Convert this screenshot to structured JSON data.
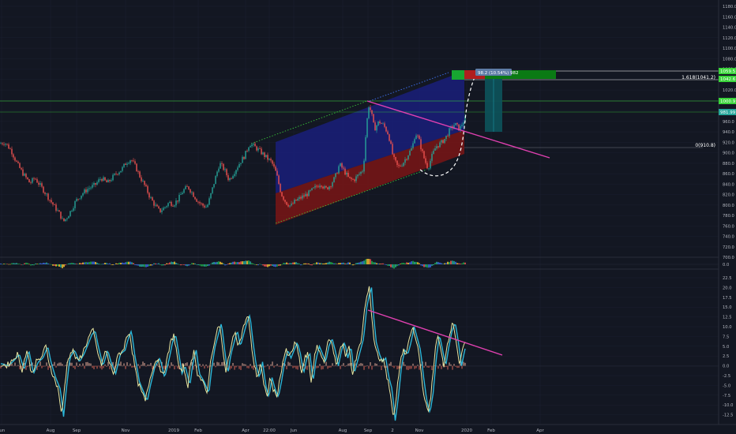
{
  "chart_data": {
    "type": "line",
    "symbol_label": "",
    "colors": {
      "background": "#131722",
      "grid": "#1c2030",
      "axis_text": "#b2b5be",
      "candle_up": "#26a69a",
      "candle_down": "#ef5350",
      "upper_channel_fill": "#1a1f7a",
      "lower_channel_fill": "#7a1515",
      "trend_line": "#e040b0",
      "profit_zone": "#0a7a14",
      "loss_zone": "#b01e1e",
      "oscillator_fast": "#e8e6a0",
      "oscillator_slow": "#2bb6d8",
      "level_green": "#3ad43a",
      "level_white": "#ffffff",
      "level_teal": "#26c6da"
    },
    "price_axis": {
      "ticks": [
        "1180.0",
        "1160.0",
        "1140.0",
        "1120.0",
        "1100.0",
        "1080.0",
        "1060.0",
        "1040.0",
        "1020.0",
        "1000.0",
        "980.0",
        "960.0",
        "940.0",
        "920.0",
        "900.0",
        "880.0",
        "860.0",
        "840.0",
        "820.0",
        "800.0",
        "780.0",
        "760.0",
        "740.0",
        "720.0",
        "700.0"
      ],
      "ylim": [
        700,
        1180
      ]
    },
    "histogram_axis": {
      "ticks": [
        "0.0"
      ]
    },
    "oscillator_axis": {
      "ticks": [
        "22.5",
        "20.0",
        "17.5",
        "15.0",
        "12.5",
        "10.0",
        "7.5",
        "5.0",
        "2.5",
        "0.0",
        "-2.5",
        "-5.0",
        "-7.5",
        "-10.0",
        "-12.5"
      ],
      "ylim": [
        -15,
        23.5
      ]
    },
    "time_axis": {
      "labels": [
        "Jun",
        "Aug",
        "Sep",
        "Nov",
        "2019",
        "Feb",
        "Apr",
        "22:00",
        "Jun",
        "Aug",
        "Sep",
        "2",
        "Nov",
        "2020",
        "Feb",
        "Apr"
      ]
    },
    "price_keypoints": [
      [
        0,
        918
      ],
      [
        6,
        920
      ],
      [
        14,
        905
      ],
      [
        22,
        878
      ],
      [
        30,
        858
      ],
      [
        38,
        842
      ],
      [
        44,
        852
      ],
      [
        52,
        835
      ],
      [
        58,
        822
      ],
      [
        64,
        808
      ],
      [
        70,
        795
      ],
      [
        76,
        782
      ],
      [
        80,
        768
      ],
      [
        84,
        775
      ],
      [
        90,
        790
      ],
      [
        96,
        808
      ],
      [
        104,
        822
      ],
      [
        112,
        832
      ],
      [
        120,
        838
      ],
      [
        128,
        852
      ],
      [
        136,
        842
      ],
      [
        142,
        852
      ],
      [
        148,
        862
      ],
      [
        154,
        868
      ],
      [
        160,
        882
      ],
      [
        166,
        888
      ],
      [
        172,
        872
      ],
      [
        178,
        852
      ],
      [
        184,
        835
      ],
      [
        190,
        815
      ],
      [
        196,
        800
      ],
      [
        202,
        788
      ],
      [
        208,
        795
      ],
      [
        214,
        805
      ],
      [
        220,
        802
      ],
      [
        226,
        812
      ],
      [
        232,
        828
      ],
      [
        238,
        835
      ],
      [
        244,
        822
      ],
      [
        250,
        808
      ],
      [
        256,
        800
      ],
      [
        262,
        796
      ],
      [
        266,
        815
      ],
      [
        272,
        848
      ],
      [
        278,
        880
      ],
      [
        284,
        868
      ],
      [
        290,
        848
      ],
      [
        296,
        862
      ],
      [
        304,
        882
      ],
      [
        310,
        895
      ],
      [
        316,
        918
      ],
      [
        322,
        912
      ],
      [
        330,
        902
      ],
      [
        338,
        890
      ],
      [
        344,
        882
      ],
      [
        350,
        860
      ],
      [
        356,
        822
      ],
      [
        362,
        805
      ],
      [
        368,
        798
      ],
      [
        374,
        808
      ],
      [
        382,
        815
      ],
      [
        390,
        822
      ],
      [
        398,
        832
      ],
      [
        406,
        842
      ],
      [
        412,
        830
      ],
      [
        418,
        838
      ],
      [
        424,
        852
      ],
      [
        430,
        878
      ],
      [
        436,
        865
      ],
      [
        442,
        850
      ],
      [
        448,
        848
      ],
      [
        454,
        858
      ],
      [
        460,
        868
      ],
      [
        464,
        952
      ],
      [
        467,
        990
      ],
      [
        470,
        978
      ],
      [
        474,
        945
      ],
      [
        480,
        960
      ],
      [
        486,
        952
      ],
      [
        492,
        935
      ],
      [
        498,
        890
      ],
      [
        504,
        872
      ],
      [
        510,
        880
      ],
      [
        516,
        895
      ],
      [
        522,
        910
      ],
      [
        526,
        938
      ],
      [
        530,
        928
      ],
      [
        534,
        905
      ],
      [
        538,
        885
      ],
      [
        542,
        870
      ],
      [
        546,
        890
      ],
      [
        552,
        912
      ],
      [
        558,
        918
      ],
      [
        564,
        928
      ],
      [
        570,
        945
      ],
      [
        576,
        955
      ],
      [
        582,
        945
      ],
      [
        586,
        958
      ],
      [
        590,
        968
      ]
    ],
    "oscillator_keypoints": [
      [
        0,
        0.5
      ],
      [
        8,
        0
      ],
      [
        16,
        1.5
      ],
      [
        22,
        3
      ],
      [
        28,
        -1
      ],
      [
        34,
        4
      ],
      [
        40,
        -2
      ],
      [
        46,
        1
      ],
      [
        52,
        2
      ],
      [
        58,
        5
      ],
      [
        62,
        1
      ],
      [
        68,
        -3
      ],
      [
        74,
        -6
      ],
      [
        78,
        -13
      ],
      [
        82,
        -5
      ],
      [
        86,
        2
      ],
      [
        92,
        4
      ],
      [
        98,
        1
      ],
      [
        104,
        3
      ],
      [
        110,
        6
      ],
      [
        114,
        8
      ],
      [
        118,
        9
      ],
      [
        122,
        5
      ],
      [
        128,
        0
      ],
      [
        134,
        4
      ],
      [
        138,
        1
      ],
      [
        144,
        -2
      ],
      [
        150,
        3
      ],
      [
        156,
        4
      ],
      [
        160,
        7
      ],
      [
        164,
        9
      ],
      [
        168,
        3
      ],
      [
        174,
        -4
      ],
      [
        178,
        -6
      ],
      [
        184,
        -9
      ],
      [
        188,
        -5
      ],
      [
        194,
        0
      ],
      [
        200,
        2
      ],
      [
        206,
        -3
      ],
      [
        212,
        2
      ],
      [
        216,
        6
      ],
      [
        220,
        8
      ],
      [
        224,
        3
      ],
      [
        228,
        -2
      ],
      [
        232,
        0
      ],
      [
        238,
        -5
      ],
      [
        242,
        1
      ],
      [
        246,
        4
      ],
      [
        250,
        -2
      ],
      [
        256,
        -4
      ],
      [
        262,
        -7
      ],
      [
        266,
        0
      ],
      [
        270,
        5
      ],
      [
        274,
        8
      ],
      [
        278,
        11
      ],
      [
        282,
        4
      ],
      [
        286,
        -2
      ],
      [
        290,
        3
      ],
      [
        294,
        6
      ],
      [
        298,
        9
      ],
      [
        302,
        5
      ],
      [
        306,
        8
      ],
      [
        310,
        11
      ],
      [
        314,
        13
      ],
      [
        318,
        6
      ],
      [
        322,
        0
      ],
      [
        326,
        -3
      ],
      [
        330,
        1
      ],
      [
        334,
        -5
      ],
      [
        338,
        -8
      ],
      [
        342,
        -3
      ],
      [
        346,
        -6
      ],
      [
        350,
        -8
      ],
      [
        354,
        -4
      ],
      [
        358,
        1
      ],
      [
        362,
        4
      ],
      [
        366,
        2
      ],
      [
        370,
        4
      ],
      [
        374,
        6
      ],
      [
        378,
        3
      ],
      [
        382,
        -2
      ],
      [
        386,
        2
      ],
      [
        390,
        3
      ],
      [
        394,
        -4
      ],
      [
        398,
        2
      ],
      [
        402,
        5
      ],
      [
        406,
        3
      ],
      [
        410,
        1
      ],
      [
        414,
        5
      ],
      [
        418,
        7
      ],
      [
        422,
        4
      ],
      [
        426,
        0
      ],
      [
        430,
        4
      ],
      [
        434,
        6
      ],
      [
        438,
        2
      ],
      [
        442,
        5
      ],
      [
        446,
        -2
      ],
      [
        450,
        1
      ],
      [
        454,
        4
      ],
      [
        458,
        7
      ],
      [
        462,
        15
      ],
      [
        465,
        18
      ],
      [
        468,
        20
      ],
      [
        471,
        12
      ],
      [
        474,
        6
      ],
      [
        478,
        3
      ],
      [
        482,
        1
      ],
      [
        486,
        2
      ],
      [
        490,
        -3
      ],
      [
        494,
        -6
      ],
      [
        498,
        -14
      ],
      [
        502,
        -8
      ],
      [
        506,
        0
      ],
      [
        510,
        4
      ],
      [
        514,
        3
      ],
      [
        518,
        6
      ],
      [
        522,
        10
      ],
      [
        526,
        7
      ],
      [
        530,
        4
      ],
      [
        534,
        -3
      ],
      [
        538,
        -9
      ],
      [
        542,
        -12
      ],
      [
        546,
        -7
      ],
      [
        550,
        2
      ],
      [
        554,
        8
      ],
      [
        558,
        4
      ],
      [
        562,
        0
      ],
      [
        566,
        5
      ],
      [
        570,
        9
      ],
      [
        574,
        11
      ],
      [
        578,
        6
      ],
      [
        582,
        0
      ],
      [
        586,
        4
      ],
      [
        590,
        7
      ]
    ],
    "annotations": {
      "fib_upper": "1.618(1041.2)",
      "fib_lower": "0(910.8)",
      "position_label": "98.2 (10.54%) 982",
      "channel_label": "",
      "price_tags": [
        "1059.5",
        "1042.6",
        "1000.9",
        "981.99"
      ]
    },
    "grid": false,
    "legend": "none"
  }
}
